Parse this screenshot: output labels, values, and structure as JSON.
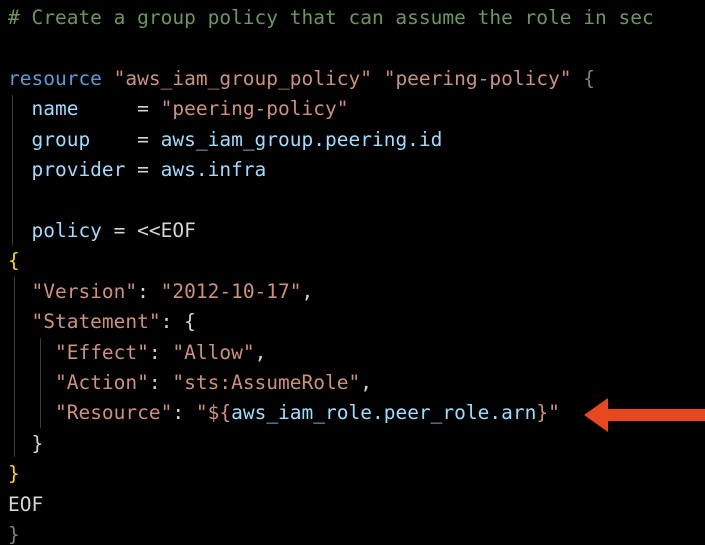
{
  "editor": {
    "theme_colors": {
      "background": "#000000",
      "comment": "#6a9955",
      "keyword": "#569cd6",
      "string": "#ce9178",
      "property": "#9cdcfe",
      "plain": "#d4d4d4",
      "brace": "#ffd700",
      "arrow": "#e8471f"
    },
    "comment": "# Create a group policy that can assume the role in sec",
    "resource": {
      "keyword": "resource",
      "type": "\"aws_iam_group_policy\"",
      "name": "\"peering-policy\"",
      "open_brace": "{",
      "close_brace": "}"
    },
    "attrs": {
      "name_key": "name",
      "name_eq": "     = ",
      "name_val": "\"peering-policy\"",
      "group_key": "group",
      "group_eq": "    = ",
      "group_val": "aws_iam_group.peering.id",
      "provider_key": "provider",
      "provider_eq": " = ",
      "provider_val": "aws.infra",
      "policy_key": "policy",
      "policy_eq": " = ",
      "heredoc_open": "<<EOF",
      "heredoc_close": "EOF"
    },
    "policy": {
      "open_brace": "{",
      "version_key": "\"Version\"",
      "version_val": "\"2012-10-17\"",
      "statement_key": "\"Statement\"",
      "statement_open": "{",
      "effect_key": "\"Effect\"",
      "effect_val": "\"Allow\"",
      "action_key": "\"Action\"",
      "action_val": "\"sts:AssumeRole\"",
      "resource_key": "\"Resource\"",
      "resource_val_prefix": "\"${",
      "resource_val_ref": "aws_iam_role.peer_role.arn",
      "resource_val_suffix": "}\"",
      "statement_close": "}",
      "close_brace": "}"
    },
    "punct": {
      "colon": ": ",
      "comma": ","
    },
    "annotation_icon": "left-arrow-icon"
  }
}
